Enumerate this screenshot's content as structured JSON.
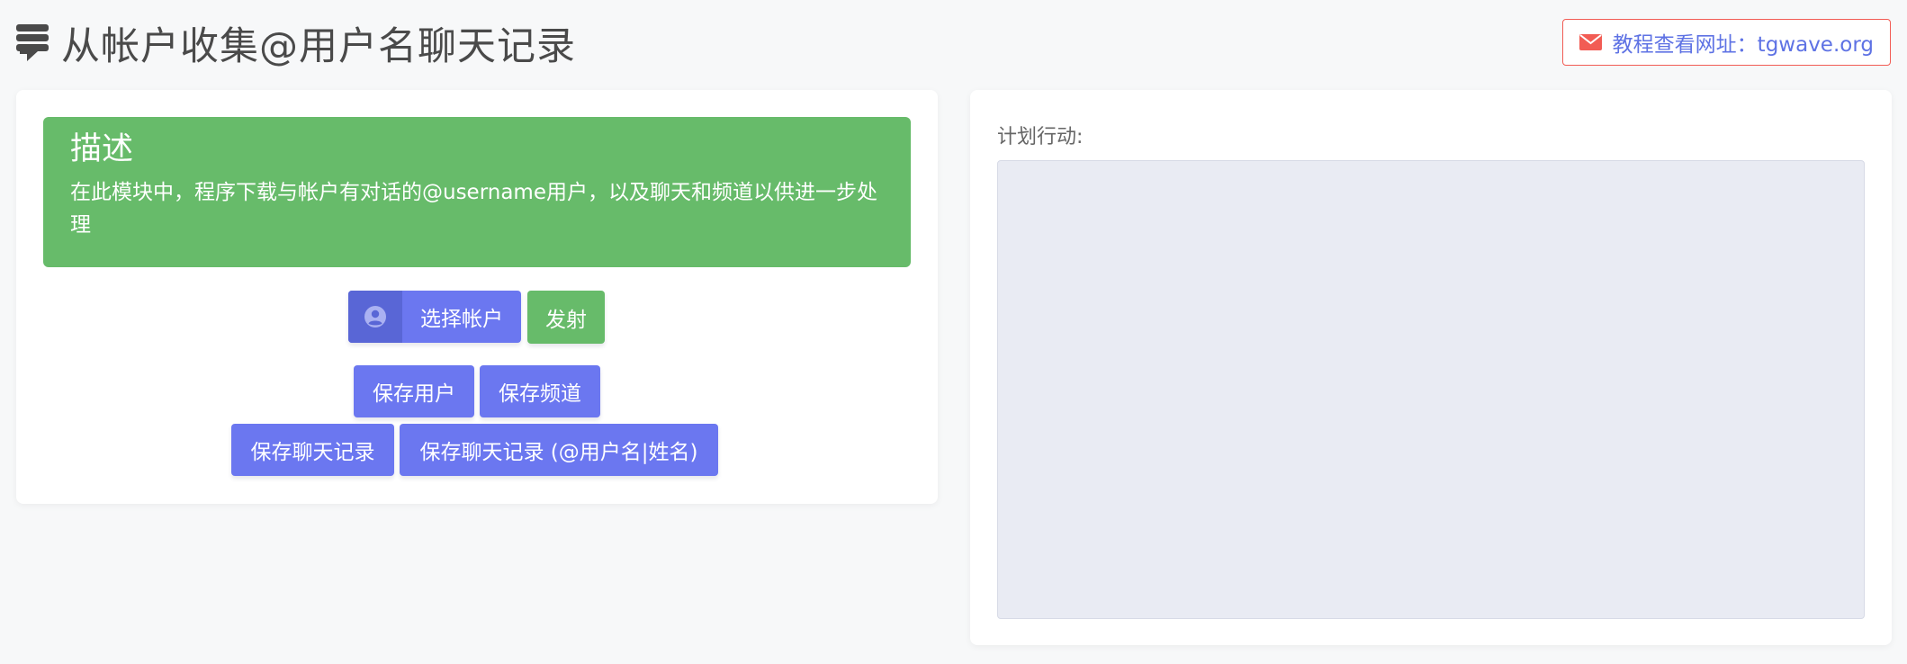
{
  "header": {
    "title": "从帐户收集@用户名聊天记录",
    "title_icon": "comment-list-icon",
    "tutorial_label": "教程查看网址：tgwave.org",
    "tutorial_icon": "envelope-icon"
  },
  "description": {
    "heading": "描述",
    "text": "在此模块中，程序下载与帐户有对话的@username用户，以及聊天和频道以供进一步处理"
  },
  "actions": {
    "select_account_label": "选择帐户",
    "select_account_icon": "user-circle-icon",
    "launch_label": "发射",
    "save_users_label": "保存用户",
    "save_channels_label": "保存频道",
    "save_chats_label": "保存聊天记录",
    "save_chats_named_label": "保存聊天记录 (@用户名|姓名)"
  },
  "plan": {
    "label": "计划行动:",
    "value": ""
  },
  "colors": {
    "primary": "#6b77f0",
    "success": "#67bb6a",
    "danger": "#f25c54",
    "link": "#5e72e4"
  }
}
